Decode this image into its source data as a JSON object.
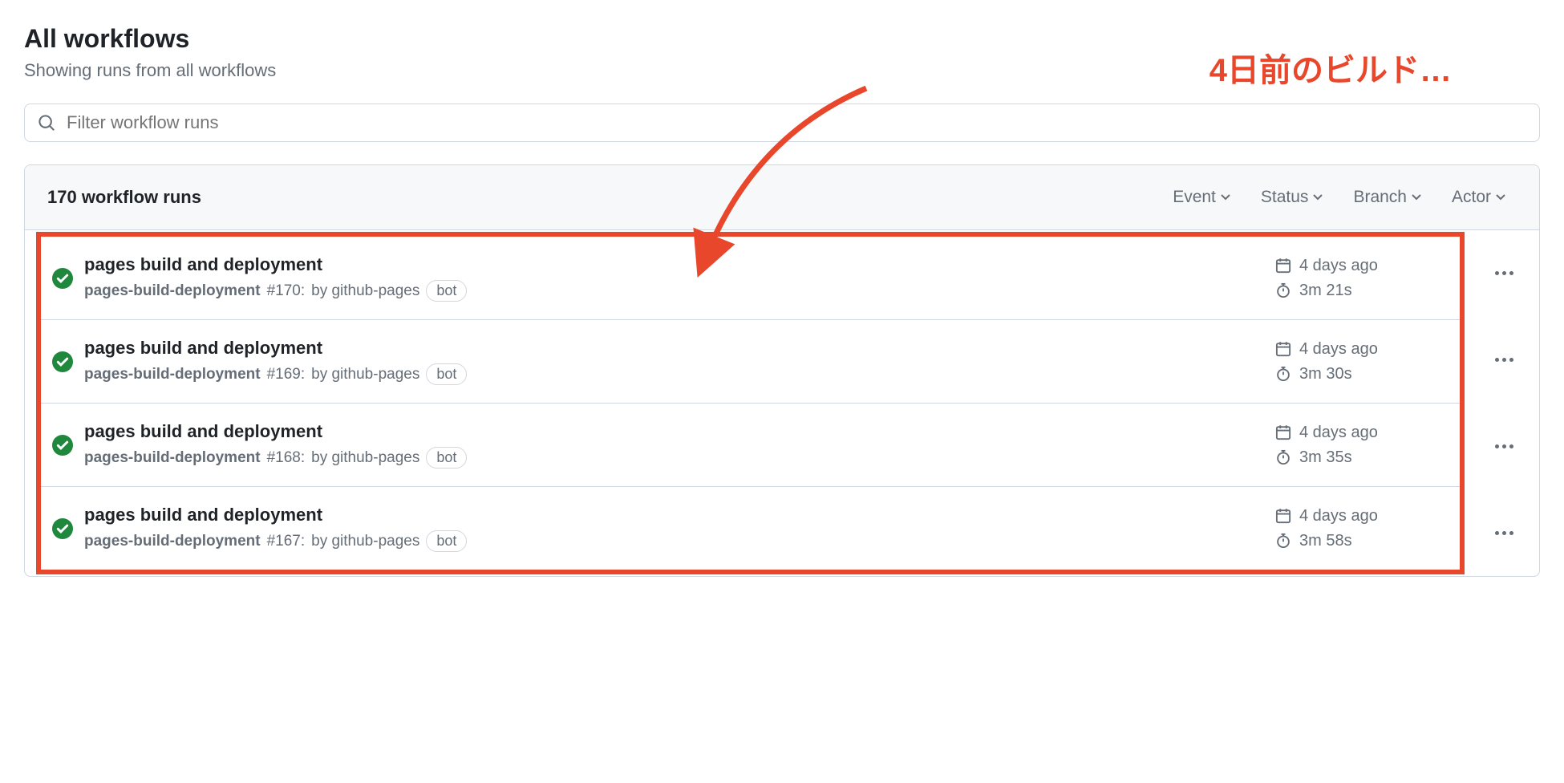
{
  "header": {
    "title": "All workflows",
    "subtitle": "Showing runs from all workflows"
  },
  "search": {
    "placeholder": "Filter workflow runs"
  },
  "annotation": {
    "text": "4日前のビルド…"
  },
  "runsHeader": {
    "count": "170 workflow runs",
    "filters": {
      "event": "Event",
      "status": "Status",
      "branch": "Branch",
      "actor": "Actor"
    }
  },
  "runs": [
    {
      "title": "pages build and deployment",
      "workflow": "pages-build-deployment",
      "runNumber": "#170:",
      "byText": "by github-pages",
      "botLabel": "bot",
      "timeAgo": "4 days ago",
      "duration": "3m 21s"
    },
    {
      "title": "pages build and deployment",
      "workflow": "pages-build-deployment",
      "runNumber": "#169:",
      "byText": "by github-pages",
      "botLabel": "bot",
      "timeAgo": "4 days ago",
      "duration": "3m 30s"
    },
    {
      "title": "pages build and deployment",
      "workflow": "pages-build-deployment",
      "runNumber": "#168:",
      "byText": "by github-pages",
      "botLabel": "bot",
      "timeAgo": "4 days ago",
      "duration": "3m 35s"
    },
    {
      "title": "pages build and deployment",
      "workflow": "pages-build-deployment",
      "runNumber": "#167:",
      "byText": "by github-pages",
      "botLabel": "bot",
      "timeAgo": "4 days ago",
      "duration": "3m 58s"
    }
  ]
}
